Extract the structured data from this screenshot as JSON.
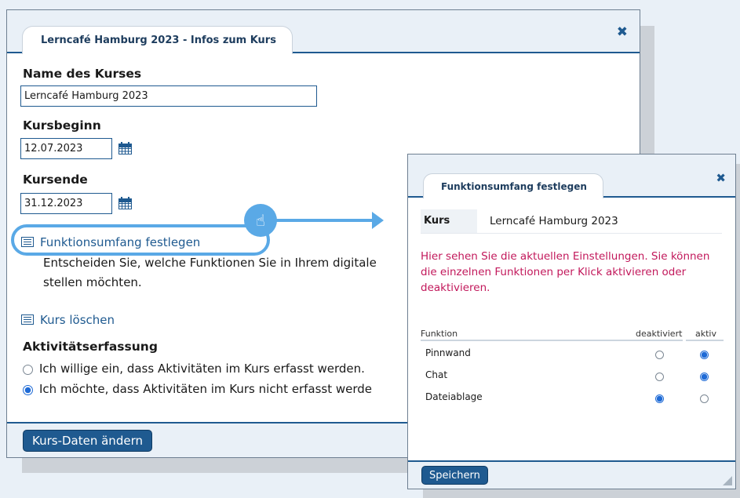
{
  "main_dialog": {
    "tab_title": "Lerncafé Hamburg 2023 - Infos zum Kurs",
    "close_icon": "close-icon",
    "name_label": "Name des Kurses",
    "name_value": "Lerncafé Hamburg 2023",
    "start_label": "Kursbeginn",
    "start_value": "12.07.2023",
    "end_label": "Kursende",
    "end_value": "31.12.2023",
    "calendar_icon": "calendar-icon",
    "scope_link": "Funktionsumfang festlegen",
    "scope_desc_line1": "Entscheiden Sie, welche Funktionen Sie in Ihrem digitale",
    "scope_desc_line2": "stellen möchten.",
    "delete_link": "Kurs löschen",
    "activity_heading": "Aktivitätserfassung",
    "consent_yes": "Ich willige ein, dass Aktivitäten im Kurs erfasst werden.",
    "consent_no": "Ich möchte, dass Aktivitäten im Kurs nicht erfasst werde",
    "consent_selected": "no",
    "submit_label": "Kurs-Daten ändern"
  },
  "pointer_icon": "hand-pointer-icon",
  "scope_dialog": {
    "tab_title": "Funktionsumfang festlegen",
    "close_icon": "close-icon",
    "kurs_label": "Kurs",
    "kurs_value": "Lerncafé Hamburg 2023",
    "info_text": "Hier sehen Sie die aktuellen Einstellungen. Sie können die einzelnen Funktionen per Klick aktivieren oder deaktivieren.",
    "col_function": "Funktion",
    "col_inactive": "deaktiviert",
    "col_active": "aktiv",
    "rows": [
      {
        "name": "Pinnwand",
        "state": "aktiv"
      },
      {
        "name": "Chat",
        "state": "aktiv"
      },
      {
        "name": "Dateiablage",
        "state": "deaktiviert"
      }
    ],
    "save_label": "Speichern"
  },
  "colors": {
    "primary": "#1f5a90",
    "highlight": "#5aa9e6",
    "info_text": "#c2185b",
    "panel_bg": "#e9f0f7"
  }
}
